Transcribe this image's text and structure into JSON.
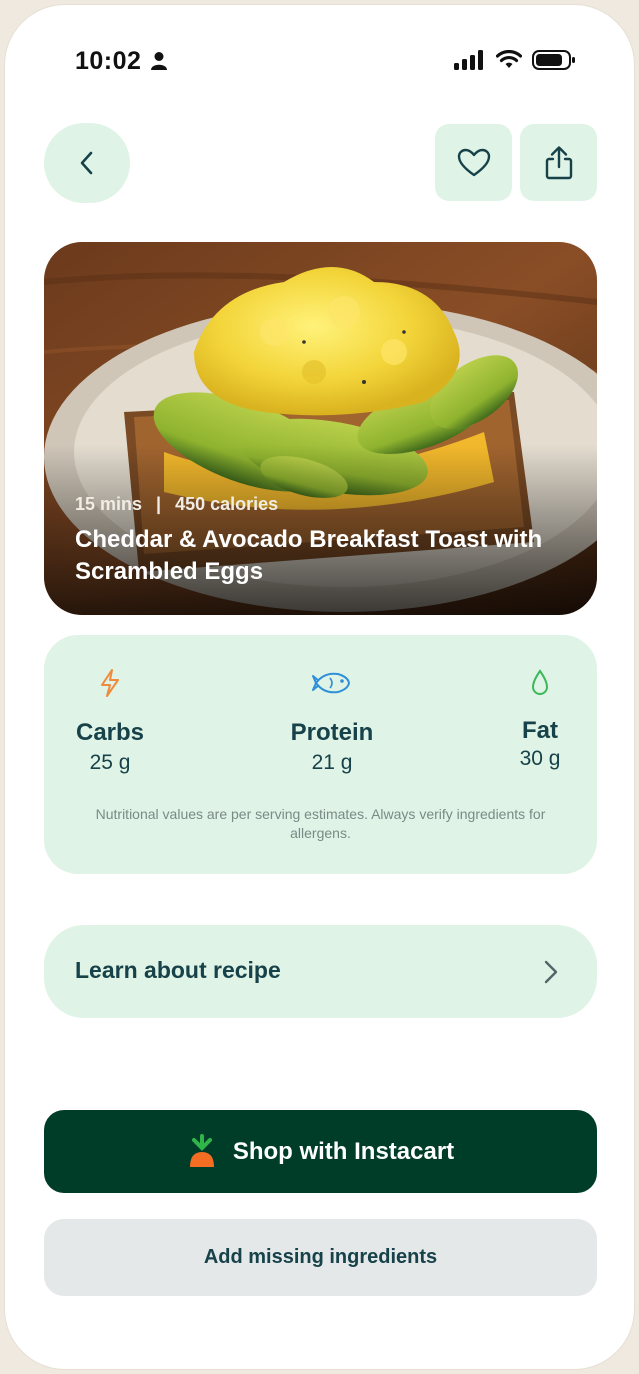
{
  "status_bar": {
    "time": "10:02"
  },
  "header": {
    "back_icon": "chevron-left-icon",
    "favorite_icon": "heart-icon",
    "share_icon": "share-icon"
  },
  "recipe": {
    "time": "15 mins",
    "separator": "|",
    "calories": "450 calories",
    "title": "Cheddar & Avocado Breakfast Toast with Scrambled Eggs"
  },
  "nutrition": {
    "macros": [
      {
        "label": "Carbs",
        "value": "25 g",
        "icon": "lightning-icon",
        "color": "#f08a3c"
      },
      {
        "label": "Protein",
        "value": "21 g",
        "icon": "fish-icon",
        "color": "#2f8fd8"
      },
      {
        "label": "Fat",
        "value": "30 g",
        "icon": "droplet-icon",
        "color": "#3cb85a"
      }
    ],
    "note": "Nutritional values are per serving estimates. Always verify ingredients for allergens."
  },
  "learn": {
    "label": "Learn about recipe"
  },
  "actions": {
    "shop_label": "Shop with Instacart",
    "add_missing_label": "Add missing ingredients"
  },
  "colors": {
    "accent_light": "#dff3e6",
    "primary_dark": "#003d29",
    "text_dark": "#17424a"
  }
}
